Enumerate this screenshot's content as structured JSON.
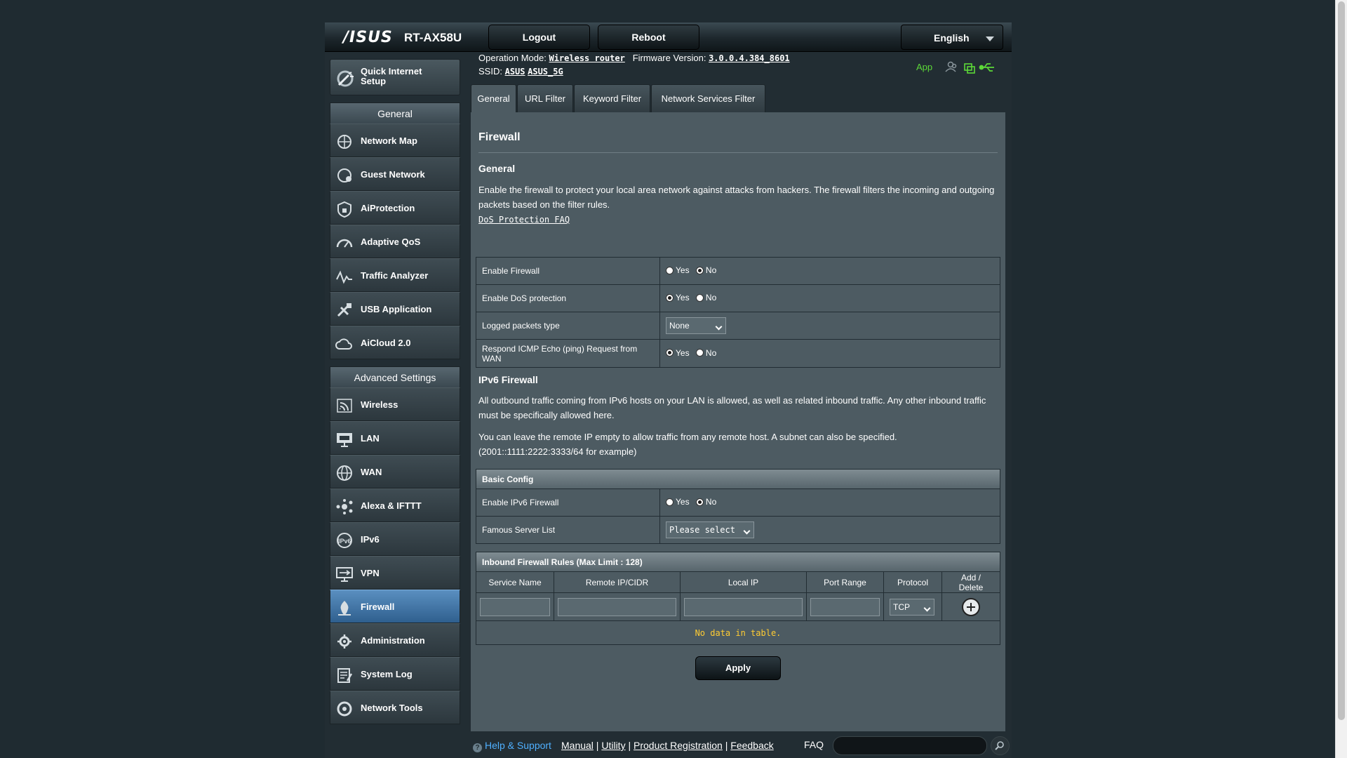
{
  "header": {
    "brand": "/ISUS",
    "model": "RT-AX58U",
    "logout_label": "Logout",
    "reboot_label": "Reboot",
    "language": "English"
  },
  "status": {
    "op_mode_label": "Operation Mode:",
    "op_mode_value": "Wireless router",
    "firmware_label": "Firmware Version:",
    "firmware_value": "3.0.0.4.384_8601",
    "ssid_label": "SSID:",
    "ssid_1": "ASUS",
    "ssid_2": "ASUS_5G",
    "app_label": "App"
  },
  "sidebar": {
    "qis_label": "Quick Internet Setup",
    "general_title": "General",
    "general_items": [
      "Network Map",
      "Guest Network",
      "AiProtection",
      "Adaptive QoS",
      "Traffic Analyzer",
      "USB Application",
      "AiCloud 2.0"
    ],
    "advanced_title": "Advanced Settings",
    "advanced_items": [
      "Wireless",
      "LAN",
      "WAN",
      "Alexa & IFTTT",
      "IPv6",
      "VPN",
      "Firewall",
      "Administration",
      "System Log",
      "Network Tools"
    ],
    "active_item": "Firewall"
  },
  "tabs": [
    "General",
    "URL Filter",
    "Keyword Filter",
    "Network Services Filter"
  ],
  "page": {
    "title": "Firewall",
    "general_heading": "General",
    "general_desc": "Enable the firewall to protect your local area network against attacks from hackers. The firewall filters the incoming and outgoing packets based on the filter rules.",
    "faq_link": "DoS Protection FAQ",
    "settings": [
      {
        "label": "Enable Firewall",
        "yes": "Yes",
        "no": "No"
      },
      {
        "label": "Enable DoS protection",
        "yes": "Yes",
        "no": "No"
      },
      {
        "label": "Logged packets type",
        "select": "None"
      },
      {
        "label": "Respond ICMP Echo (ping) Request from WAN",
        "yes": "Yes",
        "no": "No"
      }
    ],
    "ipv6_heading": "IPv6 Firewall",
    "ipv6_desc1": "All outbound traffic coming from IPv6 hosts on your LAN is allowed, as well as related inbound traffic. Any other inbound traffic must be specifically allowed here.",
    "ipv6_desc2": "You can leave the remote IP empty to allow traffic from any remote host. A subnet can also be specified. (2001::1111:2222:3333/64 for example)",
    "basic_config_title": "Basic Config",
    "enable_ipv6_label": "Enable IPv6 Firewall",
    "famous_server_label": "Famous Server List",
    "famous_server_select": "Please select",
    "inbound_title": "Inbound Firewall Rules (Max Limit : 128)",
    "inbound_columns": [
      "Service Name",
      "Remote IP/CIDR",
      "Local IP",
      "Port Range",
      "Protocol",
      "Add / Delete"
    ],
    "protocol_value": "TCP",
    "no_data": "No data in table.",
    "apply_label": "Apply"
  },
  "footer": {
    "help": "Help & Support",
    "manual": "Manual",
    "utility": "Utility",
    "registration": "Product Registration",
    "feedback": "Feedback",
    "faq": "FAQ"
  },
  "colors": {
    "accent_blue": "#2f5f8e",
    "status_green": "#5cd838",
    "nodata_yellow": "#ffcc33"
  }
}
